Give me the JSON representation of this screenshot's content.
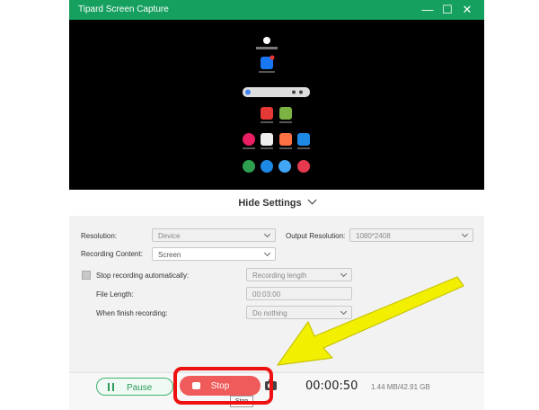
{
  "window": {
    "title": "Tipard Screen Capture",
    "controls": [
      "minimize",
      "maximize",
      "close"
    ]
  },
  "preview": {
    "description_hidden": true
  },
  "settings_toggle": {
    "label": "Hide Settings"
  },
  "settings": {
    "resolution_label": "Resolution:",
    "resolution_value": "Device",
    "output_resolution_label": "Output Resolution:",
    "output_resolution_value": "1080*2408",
    "recording_content_label": "Recording Content:",
    "recording_content_value": "Screen",
    "stop_auto_label": "Stop recording automatically:",
    "stop_auto_value": "Recording length",
    "file_length_label": "File Length:",
    "file_length_value": "00:03:00",
    "when_finish_label": "When finish recording:",
    "when_finish_value": "Do nothing"
  },
  "controls": {
    "pause_label": "Pause",
    "stop_label": "Stop",
    "timer": "00:00:50",
    "size": "1.44 MB/42.91 GB",
    "stop_tooltip": "Stop"
  },
  "colors": {
    "title_bar": "#16a05f",
    "stop_button": "#ef5a5a",
    "highlight_box": "#ee1111",
    "arrow": "#f2f000"
  }
}
